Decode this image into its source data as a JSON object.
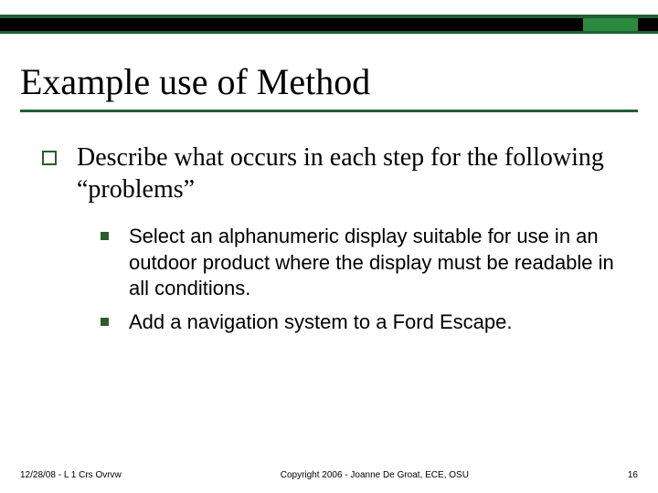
{
  "title": "Example use of Method",
  "bullets": {
    "lvl1": "Describe what occurs in each step for the following “problems”",
    "lvl2": [
      "Select an alphanumeric display suitable for use in an outdoor product where the display must be readable in all conditions.",
      "Add a navigation system to a Ford Escape."
    ]
  },
  "footer": {
    "left": "12/28/08 - L 1 Crs Ovrvw",
    "center": "Copyright 2006 - Joanne De Groat, ECE, OSU",
    "right": "16"
  }
}
